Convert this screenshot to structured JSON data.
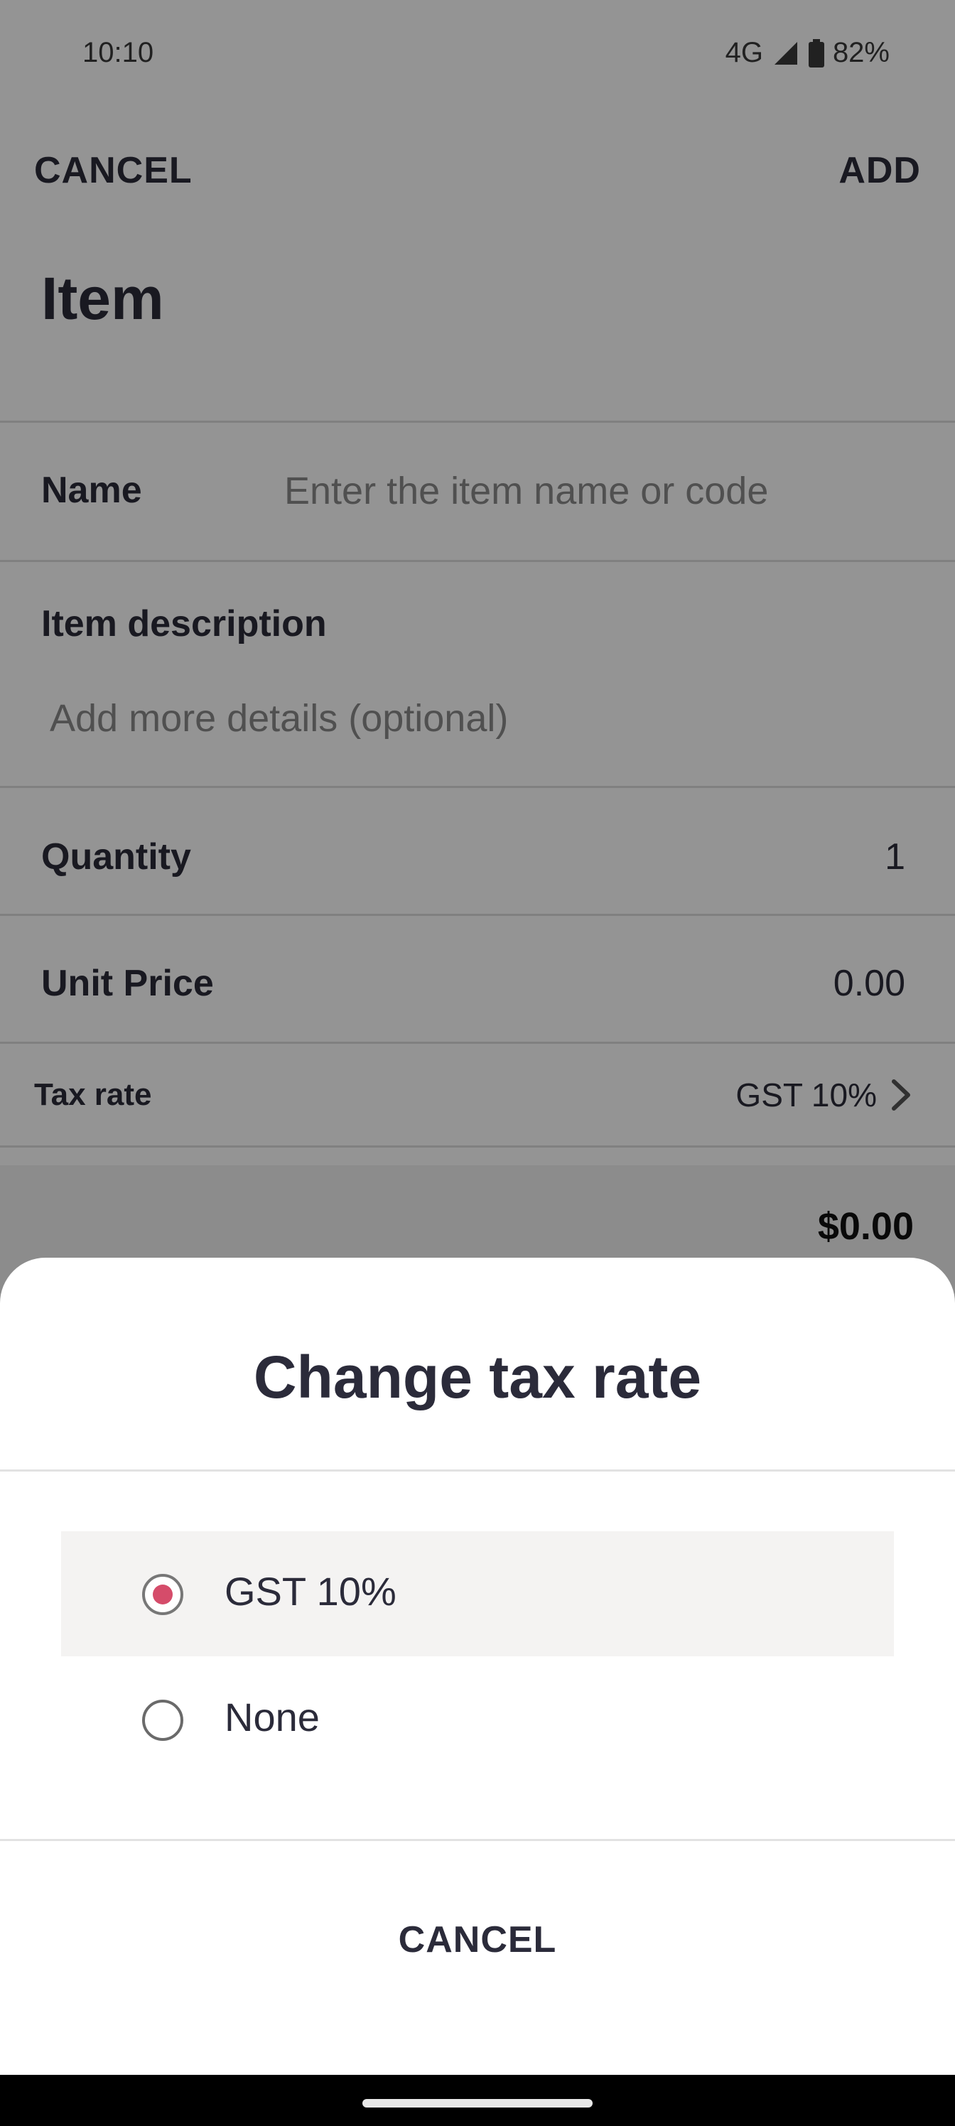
{
  "status_bar": {
    "time": "10:10",
    "network": "4G",
    "battery": "82%"
  },
  "top_bar": {
    "cancel_label": "CANCEL",
    "add_label": "ADD"
  },
  "page": {
    "title": "Item"
  },
  "form": {
    "name": {
      "label": "Name",
      "placeholder": "Enter the item name or code"
    },
    "description": {
      "label": "Item description",
      "placeholder": "Add more details (optional)"
    },
    "quantity": {
      "label": "Quantity",
      "value": "1"
    },
    "unit_price": {
      "label": "Unit Price",
      "value": "0.00"
    },
    "tax_rate": {
      "label": "Tax rate",
      "value": "GST 10%"
    },
    "total": "$0.00"
  },
  "sheet": {
    "title": "Change tax rate",
    "options": [
      {
        "label": "GST 10%",
        "selected": true
      },
      {
        "label": "None",
        "selected": false
      }
    ],
    "cancel_label": "CANCEL"
  },
  "colors": {
    "accent": "#d54c6a",
    "text": "#2b2b3a",
    "selected_row": "#f4f3f2"
  }
}
